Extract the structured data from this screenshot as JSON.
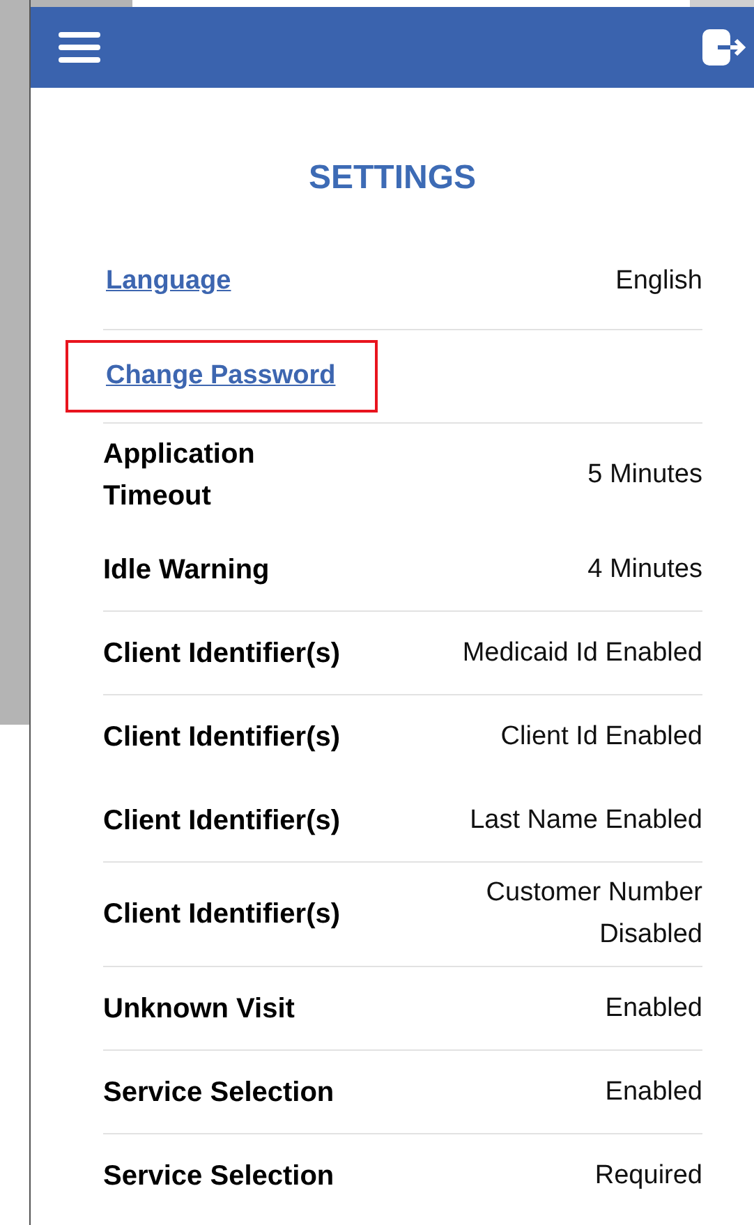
{
  "title": "SETTINGS",
  "rows": [
    {
      "kind": "link",
      "label": "Language",
      "value": "English",
      "highlighted": false,
      "separator": false
    },
    {
      "kind": "link",
      "label": "Change Password",
      "highlighted": true,
      "separator": true
    },
    {
      "kind": "setting",
      "label": "Application Timeout",
      "value": "5 Minutes",
      "separator": true
    },
    {
      "kind": "setting",
      "label": "Idle Warning",
      "value": "4 Minutes",
      "separator": false
    },
    {
      "kind": "setting",
      "label": "Client Identifier(s)",
      "value": "Medicaid Id Enabled",
      "separator": true
    },
    {
      "kind": "setting",
      "label": "Client Identifier(s)",
      "value": "Client Id Enabled",
      "separator": true
    },
    {
      "kind": "setting",
      "label": "Client Identifier(s)",
      "value": "Last Name Enabled",
      "separator": false
    },
    {
      "kind": "setting",
      "label": "Client Identifier(s)",
      "value": "Customer Number Disabled",
      "separator": true
    },
    {
      "kind": "setting",
      "label": "Unknown Visit",
      "value": "Enabled",
      "separator": true
    },
    {
      "kind": "setting",
      "label": "Service Selection",
      "value": "Enabled",
      "separator": true
    },
    {
      "kind": "setting",
      "label": "Service Selection",
      "value": "Required",
      "separator": true
    }
  ]
}
